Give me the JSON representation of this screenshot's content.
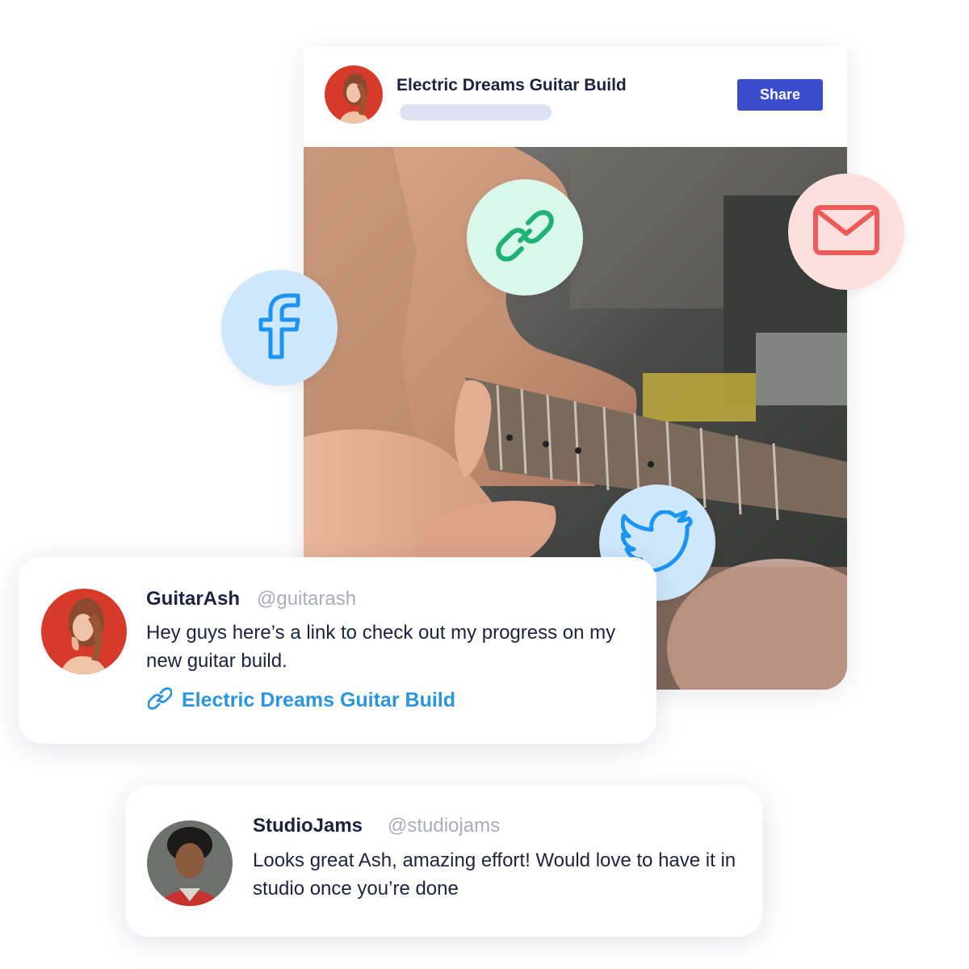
{
  "post": {
    "title": "Electric Dreams Guitar Build",
    "share_label": "Share",
    "author_avatar": "red-haired-woman-avatar",
    "photo": "hands-holding-wooden-guitar-body-photo"
  },
  "share_options": [
    {
      "name": "facebook",
      "icon": "facebook-icon",
      "bg": "#cfe7fb",
      "color": "#1b95f1"
    },
    {
      "name": "link",
      "icon": "link-icon",
      "bg": "#d9f7ea",
      "color": "#1fb176"
    },
    {
      "name": "email",
      "icon": "mail-icon",
      "bg": "#fde0de",
      "color": "#ef5a5a"
    },
    {
      "name": "twitter",
      "icon": "twitter-icon",
      "bg": "#cfe7fb",
      "color": "#1b95f1"
    }
  ],
  "comments": [
    {
      "name": "GuitarAsh",
      "handle": "@guitarash",
      "text": "Hey guys here’s a link to check out my progress on my new guitar build.",
      "link_text": "Electric Dreams Guitar Build",
      "avatar": "red-haired-woman-avatar"
    },
    {
      "name": "StudioJams",
      "handle": "@studiojams",
      "text": "Looks great Ash, amazing effort! Would love to have it in studio once you’re done",
      "avatar": "curly-haired-man-avatar"
    }
  ],
  "colors": {
    "accent": "#3a4dcb",
    "link": "#2a94dd",
    "text": "#1c2340",
    "muted": "#a9acbe"
  }
}
